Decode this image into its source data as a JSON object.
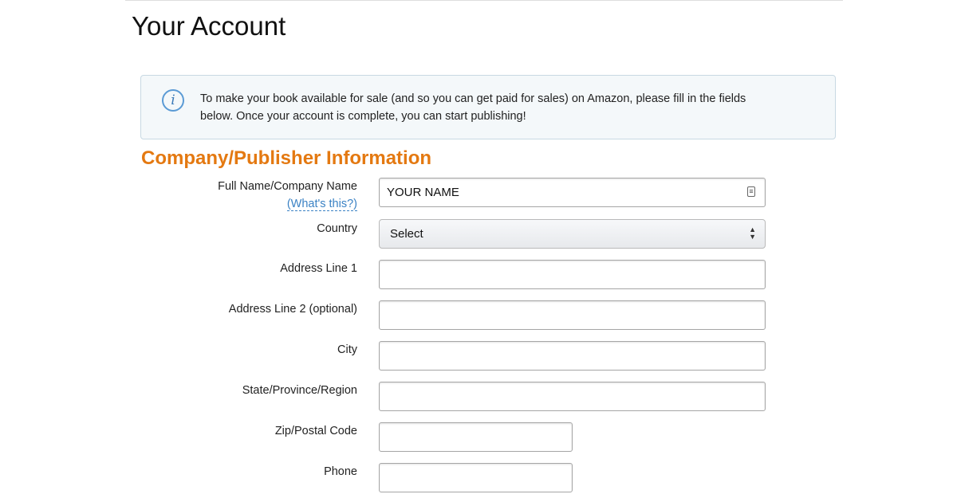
{
  "page": {
    "title": "Your Account"
  },
  "notice": {
    "icon": "info-icon",
    "line1": "To make your book available for sale (and so you can get paid for sales) on Amazon, please fill in the fields",
    "line2": "below. Once your account is complete, you can start publishing!"
  },
  "section": {
    "heading": "Company/Publisher Information",
    "accent_color": "#e47911"
  },
  "form": {
    "full_name": {
      "label": "Full Name/Company Name",
      "help_link": "(What's this?)",
      "value": "YOUR NAME"
    },
    "country": {
      "label": "Country",
      "selected": "Select"
    },
    "address1": {
      "label": "Address Line 1",
      "value": ""
    },
    "address2": {
      "label": "Address Line 2 (optional)",
      "value": ""
    },
    "city": {
      "label": "City",
      "value": ""
    },
    "state": {
      "label": "State/Province/Region",
      "value": ""
    },
    "zip": {
      "label": "Zip/Postal Code",
      "value": ""
    },
    "phone": {
      "label": "Phone",
      "value": ""
    }
  }
}
